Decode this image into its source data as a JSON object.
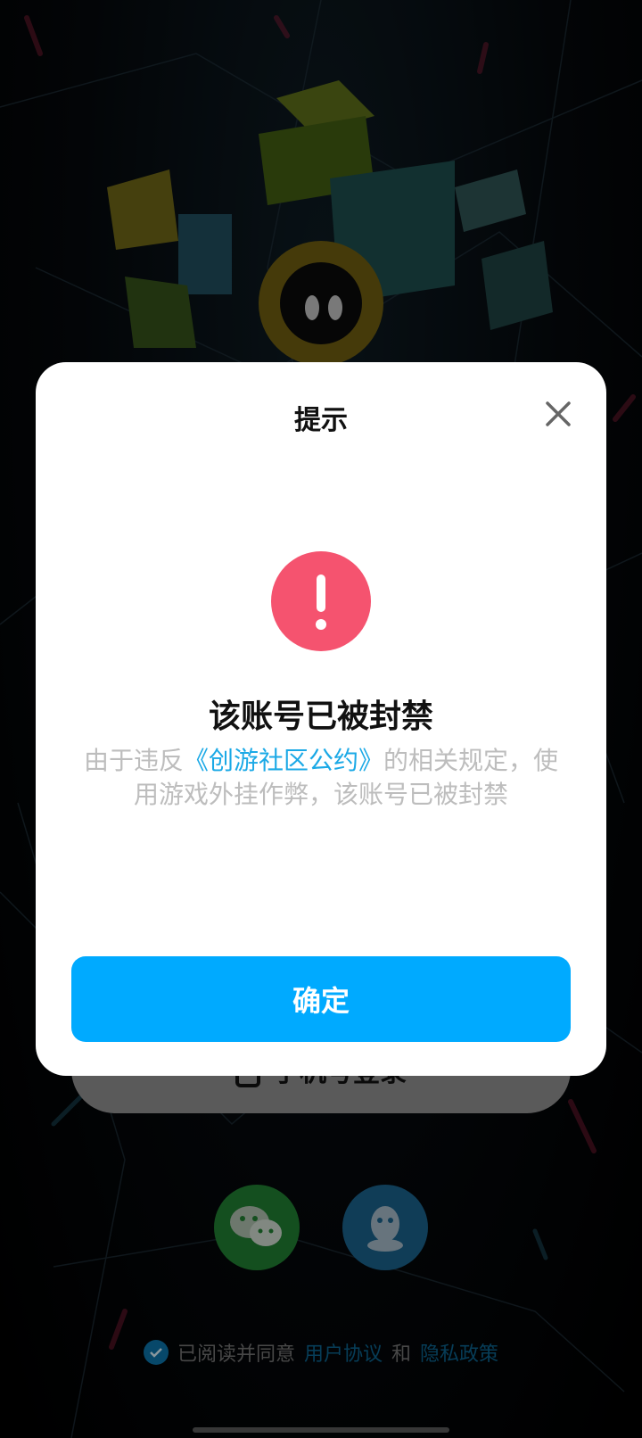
{
  "dialog": {
    "title": "提示",
    "headline": "该账号已被封禁",
    "message_before": "由于违反",
    "message_link": "《创游社区公约》",
    "message_after": "的相关规定，使用游戏外挂作弊，该账号已被封禁",
    "confirm_label": "确定",
    "alert_color": "#f5536f",
    "confirm_color": "#00aaff",
    "link_color": "#1ba9e6"
  },
  "login": {
    "phone_login_label": "手机号登录"
  },
  "agreement": {
    "prefix": "已阅读并同意",
    "user_agreement": "用户协议",
    "and": "和",
    "privacy_policy": "隐私政策",
    "checked": true
  },
  "icons": {
    "close": "close-icon",
    "alert": "exclamation-icon",
    "phone": "phone-icon",
    "wechat": "wechat-icon",
    "qq": "qq-icon",
    "check": "check-icon"
  }
}
